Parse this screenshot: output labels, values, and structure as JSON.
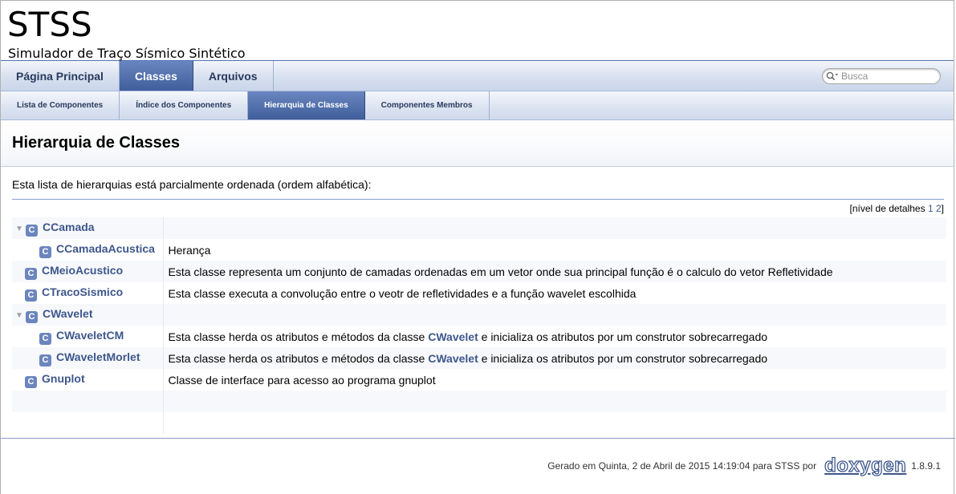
{
  "project": {
    "name": "STSS",
    "brief": "Simulador de Traço Sísmico Sintético"
  },
  "main_tabs": [
    {
      "label": "Página Principal"
    },
    {
      "label": "Classes"
    },
    {
      "label": "Arquivos"
    }
  ],
  "search": {
    "placeholder": "Busca"
  },
  "sub_tabs": [
    {
      "label": "Lista de Componentes"
    },
    {
      "label": "Índice dos Componentes"
    },
    {
      "label": "Hierarquia de Classes"
    },
    {
      "label": "Componentes Membros"
    }
  ],
  "page": {
    "title": "Hierarquia de Classes",
    "intro": "Esta lista de hierarquias está parcialmente ordenada (ordem alfabética):",
    "levels_prefix": "[nível de detalhes",
    "level_1": "1",
    "level_2": "2",
    "levels_suffix": "]"
  },
  "rows": [
    {
      "icon": "C",
      "name": "CCamada",
      "desc": ""
    },
    {
      "icon": "C",
      "name": "CCamadaAcustica",
      "desc": "Herança"
    },
    {
      "icon": "C",
      "name": "CMeioAcustico",
      "desc": "Esta classe representa um conjunto de camadas ordenadas em um vetor onde sua principal função é o calculo do vetor Refletividade"
    },
    {
      "icon": "C",
      "name": "CTracoSismico",
      "desc": "Esta classe executa a convolução entre o veotr de refletividades e a função wavelet escolhida"
    },
    {
      "icon": "C",
      "name": "CWavelet",
      "desc": ""
    },
    {
      "icon": "C",
      "name": "CWaveletCM",
      "desc_pre": "Esta classe herda os atributos e métodos da classe ",
      "desc_link": "CWavelet",
      "desc_post": " e inicializa os atributos por um construtor sobrecarregado"
    },
    {
      "icon": "C",
      "name": "CWaveletMorlet",
      "desc_pre": "Esta classe herda os atributos e métodos da classe ",
      "desc_link": "CWavelet",
      "desc_post": " e inicializa os atributos por um construtor sobrecarregado"
    },
    {
      "icon": "C",
      "name": "Gnuplot",
      "desc": "Classe de interface para acesso ao programa gnuplot"
    }
  ],
  "footer": {
    "text": "Gerado em Quinta, 2 de Abril de 2015 14:19:04 para STSS por",
    "logo": "doxygen",
    "version": "1.8.9.1"
  },
  "colors": {
    "link": "#3d578c",
    "tab_active": "#4a6aa8",
    "icon_bg": "#6b85bd"
  },
  "icons": {
    "expand": "triangle-down-icon",
    "class": "class-c-icon",
    "search": "magnifier-icon"
  }
}
